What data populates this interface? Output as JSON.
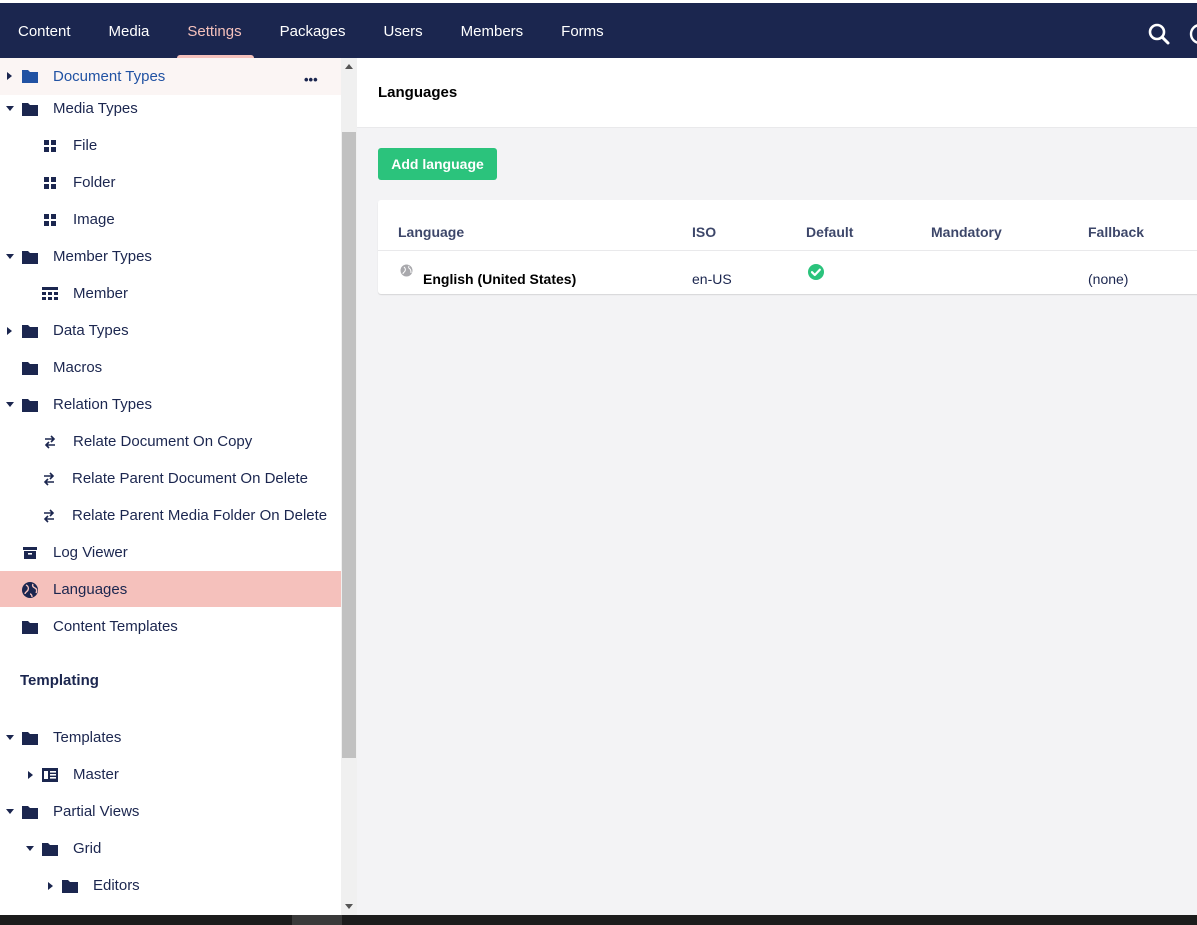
{
  "topnav": {
    "tabs": [
      {
        "label": "Content"
      },
      {
        "label": "Media"
      },
      {
        "label": "Settings",
        "active": true
      },
      {
        "label": "Packages"
      },
      {
        "label": "Users"
      },
      {
        "label": "Members"
      },
      {
        "label": "Forms"
      }
    ]
  },
  "sidebar": {
    "items": [
      {
        "label": "Document Types",
        "icon": "folder-icon"
      },
      {
        "label": "Media Types",
        "icon": "folder-icon"
      },
      {
        "label": "File",
        "icon": "grid-icon"
      },
      {
        "label": "Folder",
        "icon": "grid-icon"
      },
      {
        "label": "Image",
        "icon": "grid-icon"
      },
      {
        "label": "Member Types",
        "icon": "folder-icon"
      },
      {
        "label": "Member",
        "icon": "member-grid-icon"
      },
      {
        "label": "Data Types",
        "icon": "folder-icon"
      },
      {
        "label": "Macros",
        "icon": "folder-icon"
      },
      {
        "label": "Relation Types",
        "icon": "folder-icon"
      },
      {
        "label": "Relate Document On Copy",
        "icon": "swap-arrows-icon"
      },
      {
        "label": "Relate Parent Document On Delete",
        "icon": "swap-arrows-icon"
      },
      {
        "label": "Relate Parent Media Folder On Delete",
        "icon": "swap-arrows-icon"
      },
      {
        "label": "Log Viewer",
        "icon": "archive-box-icon"
      },
      {
        "label": "Languages",
        "icon": "globe-icon",
        "selected": true
      },
      {
        "label": "Content Templates",
        "icon": "folder-icon"
      },
      {
        "label": "Templates",
        "icon": "folder-icon"
      },
      {
        "label": "Master",
        "icon": "template-icon"
      },
      {
        "label": "Partial Views",
        "icon": "folder-icon"
      },
      {
        "label": "Grid",
        "icon": "folder-icon"
      },
      {
        "label": "Editors",
        "icon": "folder-icon"
      }
    ],
    "templating_heading": "Templating",
    "more_glyph": "•••"
  },
  "main": {
    "title": "Languages",
    "add_button_label": "Add language",
    "table": {
      "headers": [
        "Language",
        "ISO",
        "Default",
        "Mandatory",
        "Fallback"
      ],
      "rows": [
        {
          "language": "English (United States)",
          "iso": "en-US",
          "default": true,
          "mandatory": "",
          "fallback": "(none)"
        }
      ]
    }
  },
  "colors": {
    "topbar": "#1b264f",
    "active_tab": "#f5c1bc",
    "selected_item": "#f5c1bc",
    "add_button": "#2bc37c",
    "check": "#2bc37c"
  }
}
